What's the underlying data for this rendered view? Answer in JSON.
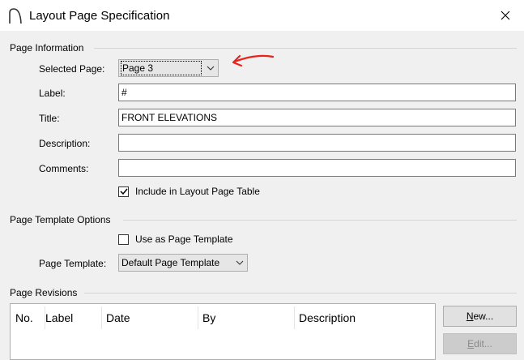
{
  "window": {
    "title": "Layout Page Specification"
  },
  "page_information": {
    "heading": "Page Information",
    "selected_page_label": "Selected Page:",
    "selected_page_value": "Page 3",
    "label_label": "Label:",
    "label_value": "#",
    "title_label": "Title:",
    "title_value": "FRONT ELEVATIONS",
    "description_label": "Description:",
    "description_value": "",
    "comments_label": "Comments:",
    "comments_value": "",
    "include_in_table_label": "Include in Layout Page Table",
    "include_in_table_checked": true
  },
  "template_options": {
    "heading": "Page Template Options",
    "use_as_template_label": "Use as Page Template",
    "use_as_template_checked": false,
    "page_template_label": "Page Template:",
    "page_template_value": "Default Page Template"
  },
  "revisions": {
    "heading": "Page Revisions",
    "columns": [
      "No.",
      "Label",
      "Date",
      "By",
      "Description"
    ],
    "rows": [],
    "buttons": {
      "new_mnemonic": "N",
      "new_rest": "ew...",
      "edit_mnemonic": "E",
      "edit_rest": "dit..."
    }
  },
  "icons": {
    "app": "arch-icon",
    "close": "close-icon",
    "dropdown": "chevron-down-icon",
    "check": "checkmark-icon",
    "annotation": "red-arrow-annotation"
  },
  "colors": {
    "annotation_red": "#e8231d",
    "window_bg": "#f0f0f0",
    "titlebar_bg": "#ffffff"
  }
}
